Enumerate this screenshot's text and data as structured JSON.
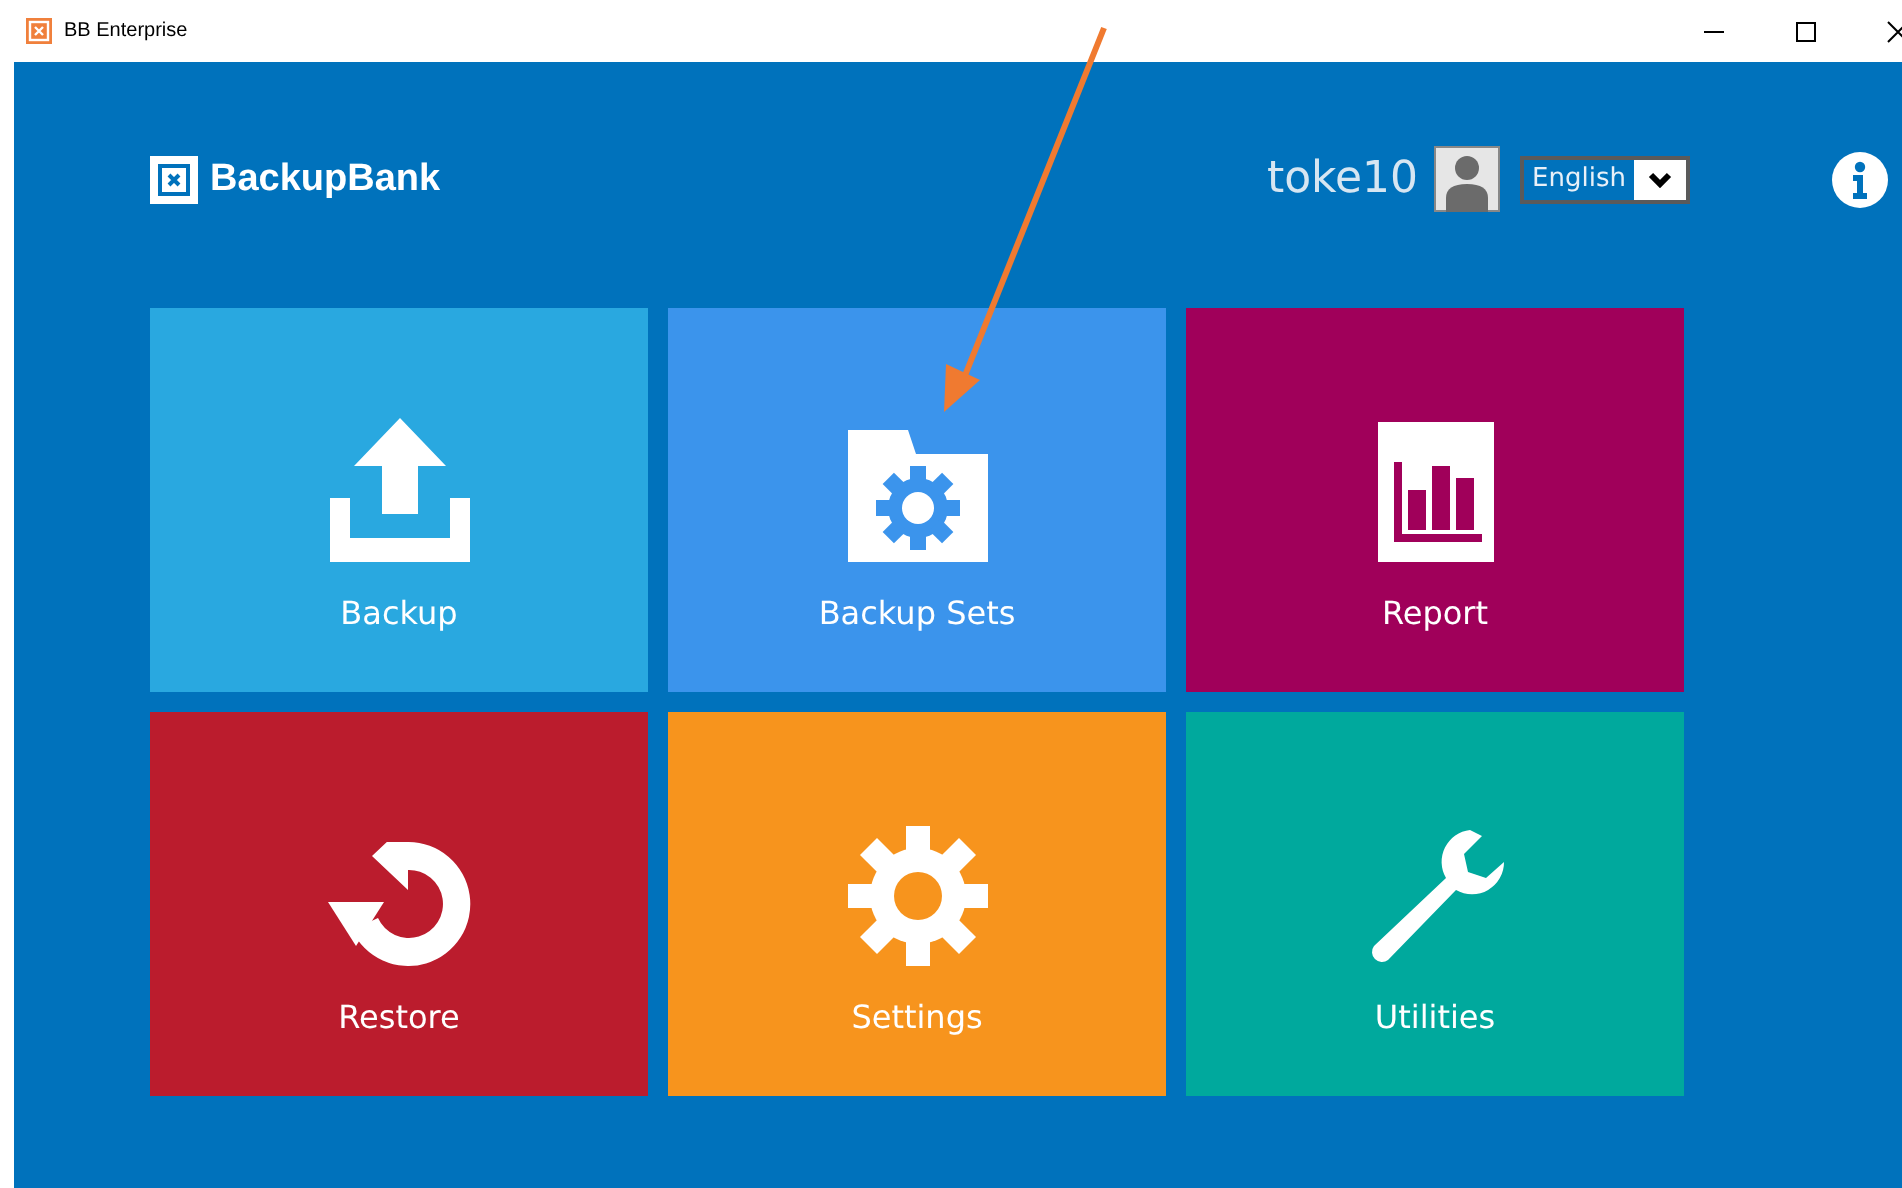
{
  "window": {
    "title": "BB Enterprise"
  },
  "header": {
    "logo": "BackupBank",
    "user": "toke10",
    "language": "English"
  },
  "tiles": [
    {
      "label": "Backup",
      "kind": "upload",
      "color": "#29a8e0"
    },
    {
      "label": "Backup Sets",
      "kind": "folder-gear",
      "color": "#3b94ec"
    },
    {
      "label": "Report",
      "kind": "chart",
      "color": "#a0005a"
    },
    {
      "label": "Restore",
      "kind": "restore",
      "color": "#bb1c2d"
    },
    {
      "label": "Settings",
      "kind": "gear",
      "color": "#f7941d"
    },
    {
      "label": "Utilities",
      "kind": "wrench",
      "color": "#00a99d"
    }
  ]
}
